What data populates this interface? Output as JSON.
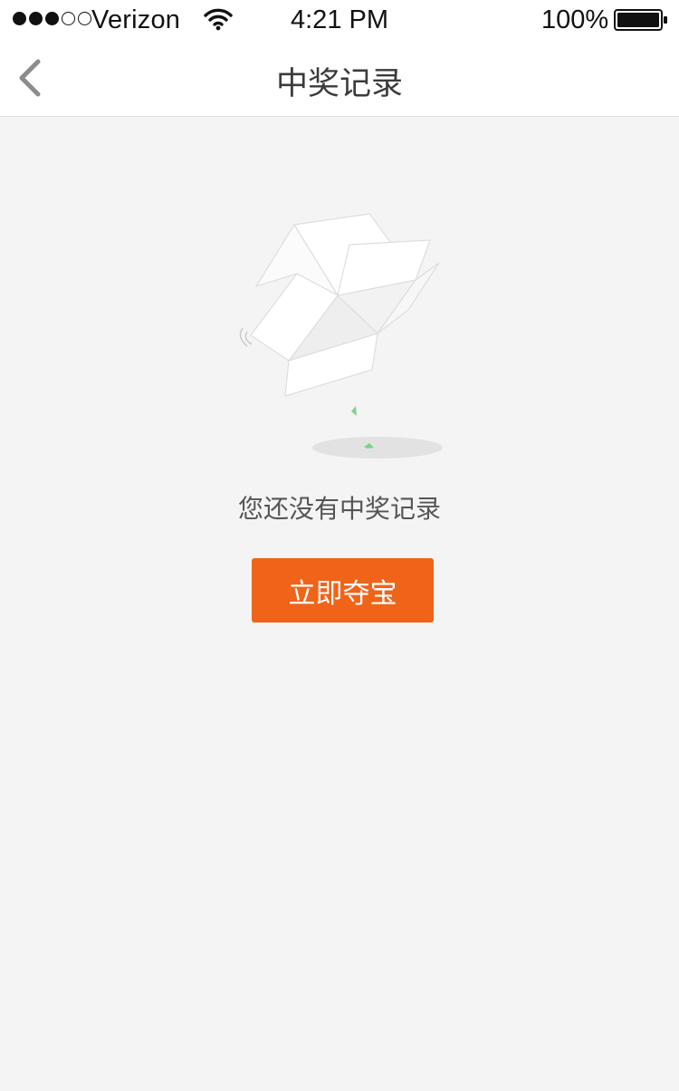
{
  "status_bar": {
    "carrier": "Verizon",
    "time": "4:21 PM",
    "battery": "100%",
    "signal_strength": 3,
    "signal_total": 5,
    "battery_level": 1.0
  },
  "nav": {
    "title": "中奖记录",
    "back_icon": "chevron-left-icon"
  },
  "empty_state": {
    "message": "您还没有中奖记录",
    "button_label": "立即夺宝",
    "illustration": "empty-box-icon"
  },
  "colors": {
    "accent": "#ef6419",
    "background": "#f4f4f4",
    "title_text": "#3b3b3b",
    "message_text": "#555555",
    "confetti": "#7dd28a"
  }
}
